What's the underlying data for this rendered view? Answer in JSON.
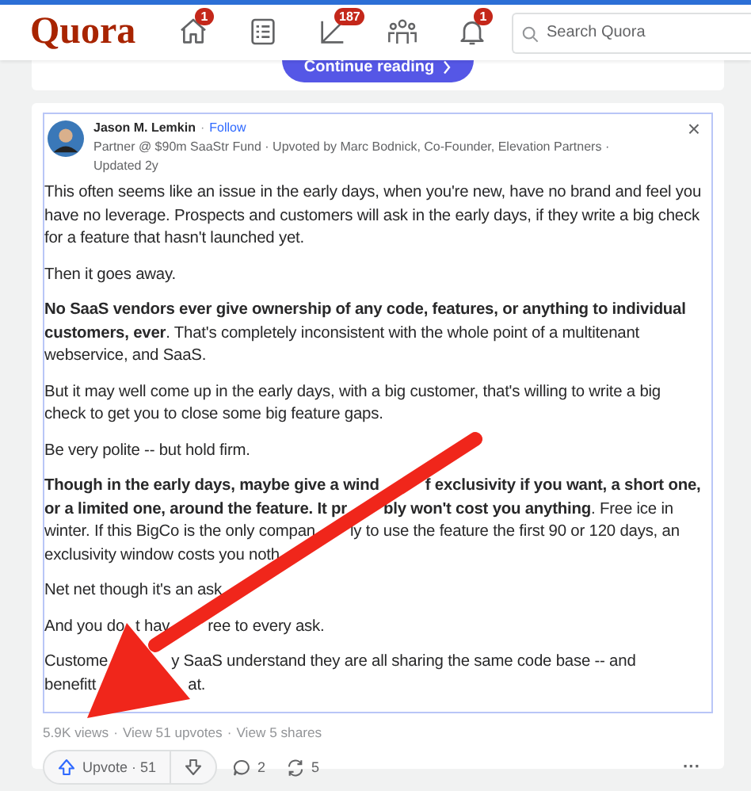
{
  "header": {
    "logo": "Quora",
    "nav": [
      {
        "kind": "home",
        "badge": "1",
        "selected": false
      },
      {
        "kind": "list",
        "selected": false
      },
      {
        "kind": "edit",
        "badge": "187",
        "selected": false
      },
      {
        "kind": "people",
        "selected": false
      },
      {
        "kind": "bell",
        "badge": "1",
        "selected": false
      }
    ],
    "search": {
      "placeholder": "Search Quora"
    }
  },
  "prev_card": {
    "button": "Continue reading"
  },
  "answer": {
    "author": "Jason M. Lemkin",
    "separator": "·",
    "follow": "Follow",
    "credential": "Partner @ $90m SaaStr Fund · Upvoted by Marc Bodnick, Co-Founder, Elevation Partners · Updated 2y",
    "close": "×",
    "paragraphs": [
      {
        "text": "This often seems like an issue in the early days, when you're new, have no brand and feel you have no leverage. Prospects and customers will ask in the early days, if they write a big check for a feature that hasn't launched yet."
      },
      {
        "text": "Then it goes away."
      },
      {
        "text": "**No SaaS vendors ever give ownership of any code, features, or anything to individual customers, ever**. That's completely inconsistent with the whole point of a multitenant webservice, and SaaS."
      },
      {
        "text": "But it may well come up in the early days, with a big customer, that's willing to write a big check to get you to close some big feature gaps."
      },
      {
        "text": "Be very polite -- but hold firm."
      },
      {
        "lines": [
          [
            {
              "text": "Though in the early days, maybe give a wind",
              "bold": true
            },
            {
              "text": "f exclusivity if you want, a short one,",
              "bold": true
            }
          ],
          [
            {
              "text": "or a limited one, around the feature. It pr",
              "bold": true
            },
            {
              "text": "**bly won't cost you anything**. Free ice in"
            }
          ],
          [
            {
              "text": "winter. If this BigCo is the only compan"
            },
            {
              "text": "ly to use the feature the first 90 or 120 days, an"
            }
          ],
          [
            {
              "text": "exclusivity window costs you noth"
            }
          ]
        ]
      },
      {
        "lines": [
          [
            {
              "text": "Net net though it's an ask"
            }
          ]
        ]
      },
      {
        "lines": [
          [
            {
              "text": "And you do"
            },
            {
              "text": "t hav"
            },
            {
              "text": "ree to every ask."
            }
          ]
        ]
      },
      {
        "lines": [
          [
            {
              "text": "Custome"
            },
            {
              "text": "y SaaS understand they are all sharing the same code base -- and"
            }
          ],
          [
            {
              "text": "benefitt"
            },
            {
              "text": "at."
            }
          ]
        ]
      }
    ],
    "views": "5.9K views",
    "stat_links": [
      "View 51 upvotes",
      "View 5 shares"
    ],
    "upvote": {
      "label": "Upvote",
      "count": "51"
    },
    "comments": "2",
    "shares": "5",
    "more": "···"
  }
}
